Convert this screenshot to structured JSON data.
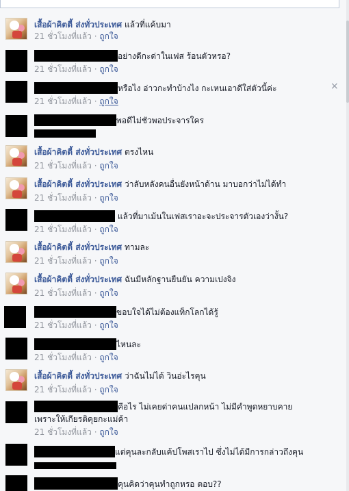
{
  "page_name": "เสื้อผ้าคิตตี้ ส่งทั่วประเทศ",
  "time_text": "21 ชั่วโมงที่แล้ว",
  "separator": " · ",
  "like_label": "ถูกใจ",
  "close_label": "×",
  "comments": [
    {
      "text": "แล้วที่แค้บมา"
    },
    {
      "text": "อย่างดีกะด่าในเฟส ร้อนตัวหรอ?"
    },
    {
      "text": "หรือไง อ่าวกะทำบ้างไง กะเหนเอาดีใส่ตัวนี้ค่ะ"
    },
    {
      "text": "พอดีไม่ชัวพอประจารใคร"
    },
    {
      "text": "ตรงไหน"
    },
    {
      "text": "ว่าลับหลังคนอื่นยังหน้าด้าน มาบอกว่าไม่ได้ทำ"
    },
    {
      "text": "แล้วที่มาเม้นในเฟสเราอะจะประจารตัวเองว่างั้น?"
    },
    {
      "text": "ทามละ"
    },
    {
      "text": "ฉันมีหลักฐานยืนยัน ความเปงจิง"
    },
    {
      "text": "ขอบใจได้ไม่ต้องแท็กโลกได้รู้"
    },
    {
      "text": "ไหนละ"
    },
    {
      "text": "ว่าฉันไม่ได้ วินอ่ะไรคุน"
    },
    {
      "text": "คือไร ไม่เคยด่าคนแปลกหน้า ไม่มีคำพูดหยาบคาย",
      "text2": "เพราะให้เกียรติคุยกะแม่ค้า"
    },
    {
      "text": "แต่คุนละกลับแค้ปโพสเราไป ซึ่งไม่ได้มีการกล่าวถึงคุน"
    },
    {
      "text": "คุนคิดว่าคุนทำถูกหรอ ตอบ??"
    }
  ]
}
